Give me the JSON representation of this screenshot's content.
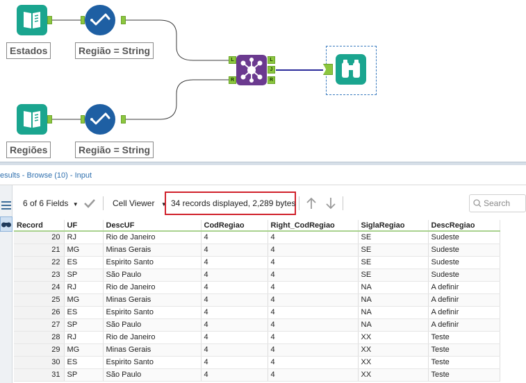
{
  "workflow": {
    "input1_label": "Estados",
    "input2_label": "Regiões",
    "select1_label": "Região = String",
    "select2_label": "Região = String",
    "join_anchors": {
      "left": "L",
      "right": "R",
      "out_left": "L",
      "out_join": "J",
      "out_right": "R"
    },
    "colors": {
      "input": "#1aa58f",
      "select": "#1e5fa3",
      "join": "#6b3a8f",
      "browse": "#1aa58f",
      "anchor": "#8cc63f",
      "wire": "#3a3a3a",
      "wire_selected": "#2a2a9a"
    }
  },
  "results": {
    "title": "esults - Browse (10) - Input",
    "fields_label": "6 of 6 Fields",
    "cell_viewer_label": "Cell Viewer",
    "record_count": "34 records displayed, 2,289 bytes",
    "search_placeholder": "Search"
  },
  "table": {
    "columns": [
      "Record",
      "UF",
      "DescUF",
      "CodRegiao",
      "Right_CodRegiao",
      "SiglaRegiao",
      "DescRegiao"
    ],
    "rows": [
      [
        "20",
        "RJ",
        "Rio de Janeiro",
        "4",
        "4",
        "SE",
        "Sudeste"
      ],
      [
        "21",
        "MG",
        "Minas Gerais",
        "4",
        "4",
        "SE",
        "Sudeste"
      ],
      [
        "22",
        "ES",
        "Espirito Santo",
        "4",
        "4",
        "SE",
        "Sudeste"
      ],
      [
        "23",
        "SP",
        "São Paulo",
        "4",
        "4",
        "SE",
        "Sudeste"
      ],
      [
        "24",
        "RJ",
        "Rio de Janeiro",
        "4",
        "4",
        "NA",
        "A definir"
      ],
      [
        "25",
        "MG",
        "Minas Gerais",
        "4",
        "4",
        "NA",
        "A definir"
      ],
      [
        "26",
        "ES",
        "Espirito Santo",
        "4",
        "4",
        "NA",
        "A definir"
      ],
      [
        "27",
        "SP",
        "São Paulo",
        "4",
        "4",
        "NA",
        "A definir"
      ],
      [
        "28",
        "RJ",
        "Rio de Janeiro",
        "4",
        "4",
        "XX",
        "Teste"
      ],
      [
        "29",
        "MG",
        "Minas Gerais",
        "4",
        "4",
        "XX",
        "Teste"
      ],
      [
        "30",
        "ES",
        "Espirito Santo",
        "4",
        "4",
        "XX",
        "Teste"
      ],
      [
        "31",
        "SP",
        "São Paulo",
        "4",
        "4",
        "XX",
        "Teste"
      ]
    ]
  }
}
